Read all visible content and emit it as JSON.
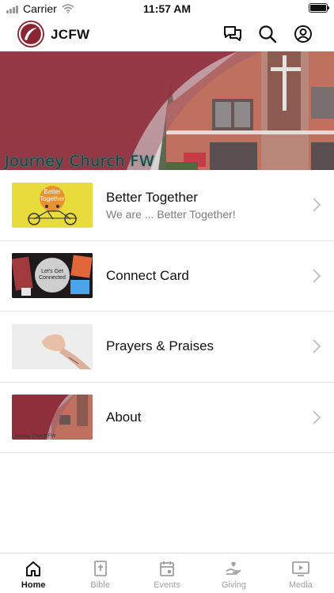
{
  "status_bar": {
    "carrier": "Carrier",
    "time": "11:57 AM",
    "battery_level": 1.0
  },
  "header": {
    "title": "JCFW",
    "icons": [
      "chat-icon",
      "search-icon",
      "account-icon"
    ]
  },
  "hero": {
    "caption": "Journey Church FW"
  },
  "list": {
    "items": [
      {
        "title": "Better Together",
        "subtitle": "We are ... Better Together!",
        "thumb_text": "Better Together"
      },
      {
        "title": "Connect Card",
        "subtitle": "",
        "thumb_text": "Let's Get Connected"
      },
      {
        "title": "Prayers & Praises",
        "subtitle": ""
      },
      {
        "title": "About",
        "subtitle": "",
        "thumb_text": "Journey Church FW"
      }
    ]
  },
  "tabs": [
    {
      "label": "Home",
      "icon": "home-icon",
      "active": true
    },
    {
      "label": "Bible",
      "icon": "bible-icon",
      "active": false
    },
    {
      "label": "Events",
      "icon": "calendar-icon",
      "active": false
    },
    {
      "label": "Giving",
      "icon": "giving-icon",
      "active": false
    },
    {
      "label": "Media",
      "icon": "media-icon",
      "active": false
    }
  ],
  "colors": {
    "brand": "#8b2433",
    "active_tab": "#111111",
    "inactive_tab": "#a0a0a0"
  }
}
